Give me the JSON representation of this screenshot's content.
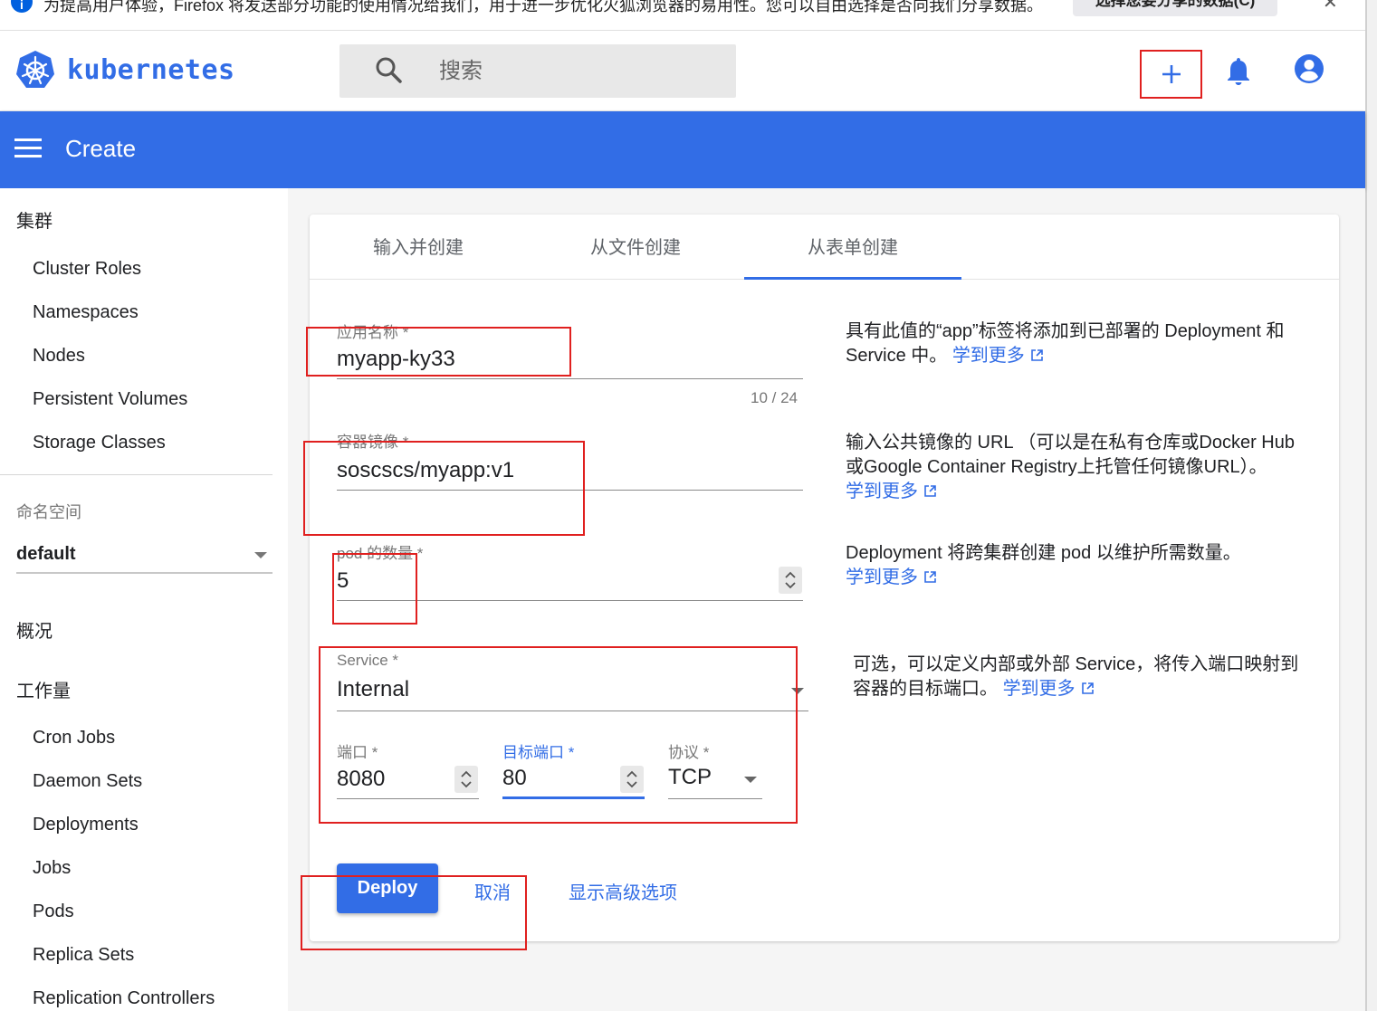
{
  "notification": {
    "message": "为提高用户体验，Firefox 将发送部分功能的使用情况给我们，用于进一步优化火狐浏览器的易用性。您可以自由选择是否向我们分享数据。",
    "button_label": "选择您要分享的数据(C)",
    "close": "✕"
  },
  "header": {
    "brand": "kubernetes",
    "search_placeholder": "搜索"
  },
  "toolbar": {
    "title": "Create"
  },
  "sidebar": {
    "cluster_heading": "集群",
    "cluster_items": [
      "Cluster Roles",
      "Namespaces",
      "Nodes",
      "Persistent Volumes",
      "Storage Classes"
    ],
    "namespace_label": "命名空间",
    "namespace_value": "default",
    "overview": "概况",
    "workloads_heading": "工作量",
    "workload_items": [
      "Cron Jobs",
      "Daemon Sets",
      "Deployments",
      "Jobs",
      "Pods",
      "Replica Sets",
      "Replication Controllers"
    ]
  },
  "tabs": [
    "输入并创建",
    "从文件创建",
    "从表单创建"
  ],
  "form": {
    "app_name": {
      "label": "应用名称 *",
      "value": "myapp-ky33",
      "counter": "10 / 24"
    },
    "image": {
      "label": "容器镜像 *",
      "value": "soscscs/myapp:v1"
    },
    "pods": {
      "label": "pod 的数量 *",
      "value": "5"
    },
    "service": {
      "label": "Service *",
      "value": "Internal"
    },
    "port": {
      "label": "端口 *",
      "value": "8080"
    },
    "target_port": {
      "label": "目标端口 *",
      "value": "80"
    },
    "protocol": {
      "label": "协议 *",
      "value": "TCP"
    }
  },
  "descriptions": {
    "app_name": {
      "text": "具有此值的“app”标签将添加到已部署的 Deployment 和 Service 中。",
      "link": "学到更多"
    },
    "image": {
      "text": "输入公共镜像的 URL （可以是在私有仓库或Docker Hub 或Google Container Registry上托管任何镜像URL）。",
      "link": "学到更多"
    },
    "pods": {
      "text": "Deployment 将跨集群创建 pod 以维护所需数量。",
      "link": "学到更多"
    },
    "service": {
      "text": "可选，可以定义内部或外部 Service，将传入端口映射到容器的目标端口。",
      "link": "学到更多"
    }
  },
  "actions": {
    "deploy": "Deploy",
    "cancel": "取消",
    "advanced": "显示高级选项"
  },
  "colors": {
    "brand": "#326de6",
    "annotation": "#e0201f"
  }
}
